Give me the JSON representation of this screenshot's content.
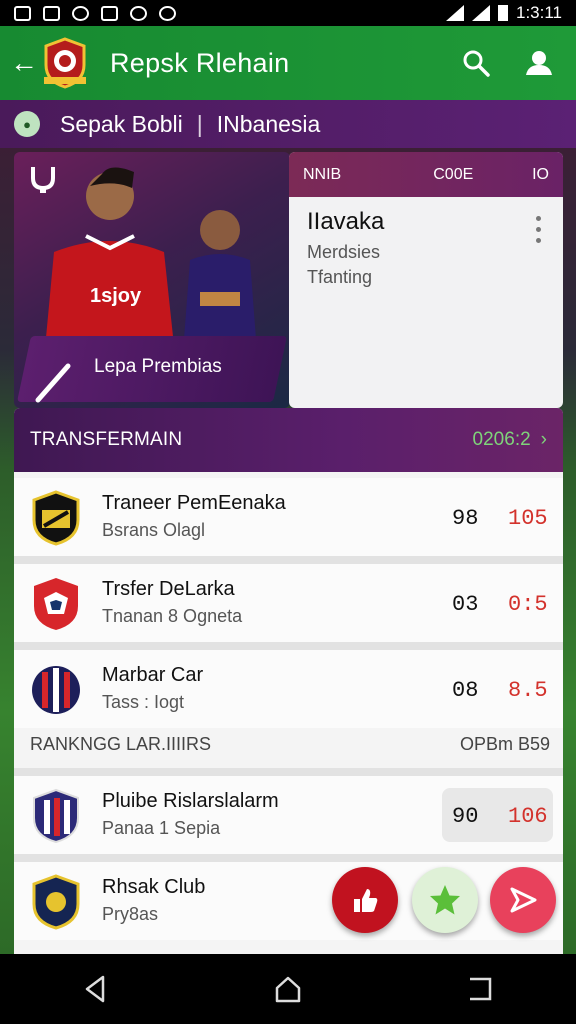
{
  "status": {
    "time": "1:3:11"
  },
  "appbar": {
    "title": "Repsk Rlehain"
  },
  "league": {
    "name": "Sepak Bobli",
    "separator": "|",
    "country": "INbanesia"
  },
  "hero": {
    "caption": "Lepa Prembias",
    "jersey_text": "1sjoy"
  },
  "info_card": {
    "head": [
      "NNIB",
      "C00E",
      "IO"
    ],
    "name": "IIavaka",
    "sub1": "Merdsies",
    "sub2": "Tfanting"
  },
  "transfer": {
    "title": "TRANSFERMAIN",
    "link_text": "0206:2",
    "rows": [
      {
        "name": "Traneer PemEenaka",
        "sub": "Bsrans Olagl",
        "v1": "98",
        "v2": "105"
      },
      {
        "name": "Trsfer DeLarka",
        "sub": "Tnanan 8 Ogneta",
        "v1": "03",
        "v2": "0:5"
      },
      {
        "name": "Marbar Car",
        "sub": "Tass : Iogt",
        "v1": "08",
        "v2": "8.5"
      },
      {
        "name": "Pluibe Rislarslalarm",
        "sub": "Panaa 1 Sepia",
        "v1": "90",
        "v2": "106"
      },
      {
        "name": "Rhsak Club",
        "sub": "Pry8as",
        "v1": "",
        "v2": ""
      }
    ],
    "ranking_label": "RANKNGG LAR.IIIIRS",
    "ranking_right": "OPBm B59"
  },
  "colors": {
    "accent_green": "#1f9a38",
    "purple": "#5b2174",
    "red": "#d3322c"
  }
}
